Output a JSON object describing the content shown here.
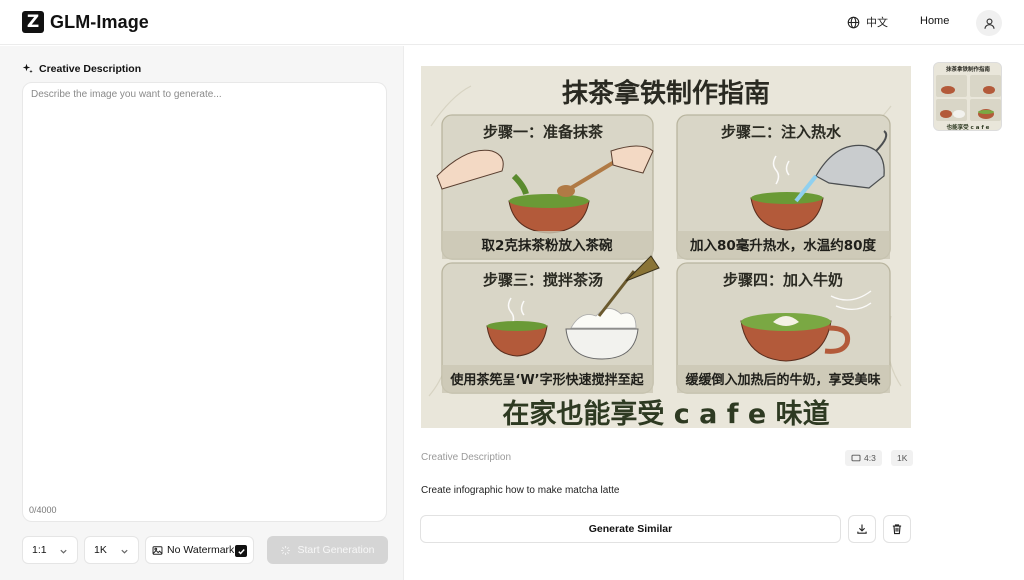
{
  "header": {
    "logo_letter": "Z",
    "app_name": "GLM-Image",
    "language_label": "中文",
    "home_label": "Home"
  },
  "left_panel": {
    "section_label": "Creative Description",
    "prompt_placeholder": "Describe the image you want to generate...",
    "prompt_value": "",
    "char_count": "0/4000",
    "aspect_ratio": "1:1",
    "resolution": "1K",
    "watermark_label": "No Watermark",
    "watermark_checked": true,
    "start_button_label": "Start Generation"
  },
  "result": {
    "info_label": "Creative Description",
    "aspect_badge": "4:3",
    "size_badge": "1K",
    "prompt_text": "Create infographic how to make matcha latte",
    "generate_similar_label": "Generate Similar"
  },
  "infographic": {
    "title": "抹茶拿铁制作指南",
    "steps": [
      {
        "heading": "步骤一：准备抹茶",
        "caption": "取2克抹茶粉放入茶碗"
      },
      {
        "heading": "步骤二：注入热水",
        "caption": "加入80毫升热水，水温约80度"
      },
      {
        "heading": "步骤三：搅拌茶汤",
        "caption": "使用茶筅呈‘W’字形快速搅拌至起"
      },
      {
        "heading": "步骤四：加入牛奶",
        "caption": "缓缓倒入加热后的牛奶，享受美味"
      }
    ],
    "footer": "在家也能享受 c a f e  味道",
    "thumb_title": "抹茶拿铁制作指南",
    "thumb_footer": "也能享受 c a f e"
  },
  "colors": {
    "accent_dark": "#111111",
    "panel_bg": "#f6f6f6",
    "disabled_button": "#d5d5d5",
    "matcha_green": "#5a8a2e",
    "bowl_terracotta": "#b35a3a",
    "card_bg": "#d9d6c7"
  },
  "icons": [
    "logo-icon",
    "globe-icon",
    "user-icon",
    "sparkle-icon",
    "chevron-down-icon",
    "image-icon",
    "check-icon",
    "loading-icon",
    "aspect-icon",
    "download-icon",
    "trash-icon"
  ]
}
